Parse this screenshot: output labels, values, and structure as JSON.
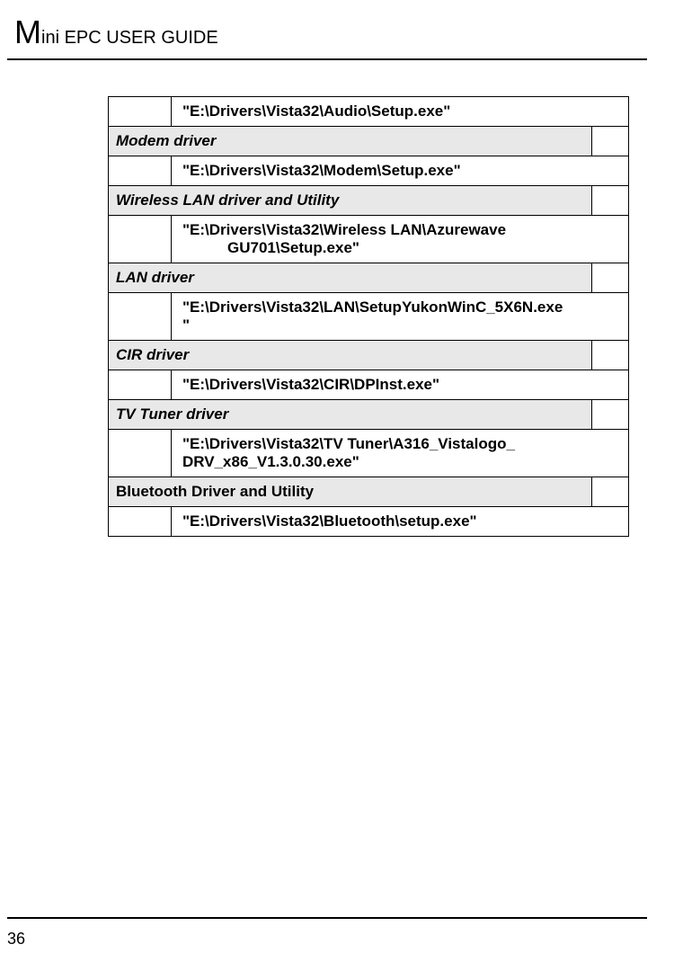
{
  "header": {
    "title_prefix": "M",
    "title_rest": "ini EPC USER GUIDE"
  },
  "rows": [
    {
      "type": "path",
      "text": "\"E:\\Drivers\\Vista32\\Audio\\Setup.exe\""
    },
    {
      "type": "category",
      "text": "Modem driver"
    },
    {
      "type": "path",
      "text": "\"E:\\Drivers\\Vista32\\Modem\\Setup.exe\""
    },
    {
      "type": "category",
      "text": "Wireless LAN driver and Utility"
    },
    {
      "type": "path_multiline",
      "line1": "\"E:\\Drivers\\Vista32\\Wireless LAN\\Azurewave",
      "line2": "GU701\\Setup.exe\""
    },
    {
      "type": "category",
      "text": "LAN driver"
    },
    {
      "type": "path_wrap",
      "line1": "\"E:\\Drivers\\Vista32\\LAN\\SetupYukonWinC_5X6N.exe",
      "line2": "\""
    },
    {
      "type": "category",
      "text": "CIR driver"
    },
    {
      "type": "path",
      "text": "\"E:\\Drivers\\Vista32\\CIR\\DPInst.exe\""
    },
    {
      "type": "category",
      "text": "TV Tuner driver"
    },
    {
      "type": "path_wrap",
      "line1": "\"E:\\Drivers\\Vista32\\TV Tuner\\A316_Vistalogo_",
      "line2": "DRV_x86_V1.3.0.30.exe\""
    },
    {
      "type": "category_noital",
      "text": "Bluetooth Driver and Utility"
    },
    {
      "type": "path",
      "text": "\"E:\\Drivers\\Vista32\\Bluetooth\\setup.exe\""
    }
  ],
  "page_number": "36"
}
